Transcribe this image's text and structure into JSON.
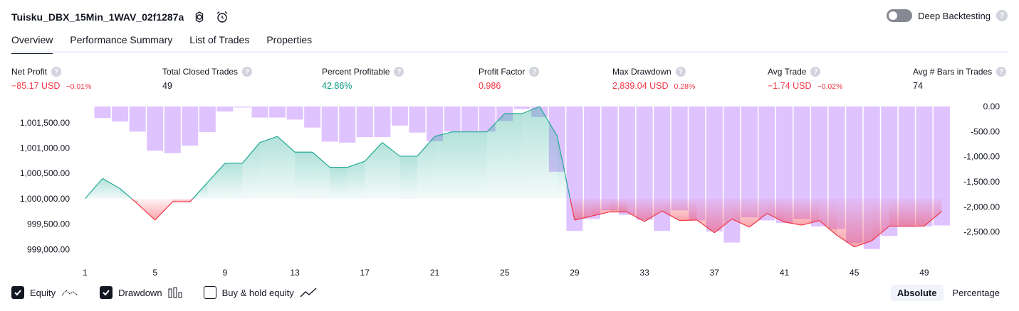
{
  "header": {
    "title": "Tuisku_DBX_15Min_1WAV_02f1287a",
    "deep_backtesting_label": "Deep Backtesting"
  },
  "tabs": [
    {
      "label": "Overview",
      "active": true
    },
    {
      "label": "Performance Summary"
    },
    {
      "label": "List of Trades"
    },
    {
      "label": "Properties"
    }
  ],
  "stats": {
    "net_profit": {
      "label": "Net Profit",
      "value": "−85.17 USD",
      "pct": "−0.01%"
    },
    "total_closed_trades": {
      "label": "Total Closed Trades",
      "value": "49"
    },
    "percent_profitable": {
      "label": "Percent Profitable",
      "value": "42.86%"
    },
    "profit_factor": {
      "label": "Profit Factor",
      "value": "0.986"
    },
    "max_drawdown": {
      "label": "Max Drawdown",
      "value": "2,839.04 USD",
      "pct": "0.28%"
    },
    "avg_trade": {
      "label": "Avg Trade",
      "value": "−1.74 USD",
      "pct": "−0.02%"
    },
    "avg_bars": {
      "label": "Avg # Bars in Trades",
      "value": "74"
    }
  },
  "chart_data": {
    "type": "line",
    "x": [
      1,
      2,
      3,
      4,
      5,
      6,
      7,
      8,
      9,
      10,
      11,
      12,
      13,
      14,
      15,
      16,
      17,
      18,
      19,
      20,
      21,
      22,
      23,
      24,
      25,
      26,
      27,
      28,
      29,
      30,
      31,
      32,
      33,
      34,
      35,
      36,
      37,
      38,
      39,
      40,
      41,
      42,
      43,
      44,
      45,
      46,
      47,
      48,
      49,
      50
    ],
    "x_tick_labels": [
      "1",
      "5",
      "9",
      "13",
      "17",
      "21",
      "25",
      "29",
      "33",
      "37",
      "41",
      "45",
      "49"
    ],
    "series": [
      {
        "name": "Equity",
        "type": "line",
        "baseline": 1000000,
        "values": [
          1000000,
          1000400,
          1000200,
          999900,
          999580,
          999940,
          999940,
          1000320,
          1000700,
          1000700,
          1001110,
          1001230,
          1000920,
          1000920,
          1000620,
          1000620,
          1000740,
          1001110,
          1000840,
          1000840,
          1001230,
          1001320,
          1001320,
          1001320,
          1001680,
          1001680,
          1001820,
          1001240,
          999580,
          999660,
          999740,
          999740,
          999550,
          999760,
          999570,
          999580,
          999330,
          999600,
          999440,
          999710,
          999540,
          999480,
          999570,
          999280,
          999050,
          999170,
          999460,
          999460,
          999460,
          999750
        ]
      },
      {
        "name": "Drawdown",
        "type": "bar",
        "values": [
          0,
          -230,
          -300,
          -500,
          -880,
          -930,
          -780,
          -510,
          -100,
          -20,
          -220,
          -220,
          -260,
          -420,
          -700,
          -720,
          -610,
          -610,
          -380,
          -520,
          -690,
          -500,
          -500,
          -500,
          -290,
          -50,
          -210,
          -1300,
          -2480,
          -2240,
          -2070,
          -2160,
          -2260,
          -2480,
          -2070,
          -2270,
          -2490,
          -2710,
          -2210,
          -2270,
          -2320,
          -2240,
          -2390,
          -2440,
          -2720,
          -2840,
          -2580,
          -2400,
          -2390,
          -2370
        ]
      }
    ],
    "left_axis": {
      "labels": [
        "1,001,500.00",
        "1,001,000.00",
        "1,000,500.00",
        "1,000,000.00",
        "999,500.00",
        "999,000.00"
      ],
      "min": 998850,
      "max": 1001820
    },
    "right_axis": {
      "labels": [
        "0.00",
        "-500.00",
        "-1,000.00",
        "-1,500.00",
        "-2,000.00",
        "-2,500.00"
      ],
      "min": -3000,
      "max": 0
    },
    "colors": {
      "equity_line": "#22ab94",
      "loss_line": "#f23645",
      "drawdown_bar": "#d9b8ff"
    }
  },
  "legend": [
    {
      "label": "Equity",
      "checked": true,
      "icon": "equity-line-icon"
    },
    {
      "label": "Drawdown",
      "checked": true,
      "icon": "bars-icon"
    },
    {
      "label": "Buy & hold equity",
      "checked": false,
      "icon": "trend-line-icon"
    }
  ],
  "modes": [
    {
      "label": "Absolute",
      "active": true
    },
    {
      "label": "Percentage"
    }
  ]
}
